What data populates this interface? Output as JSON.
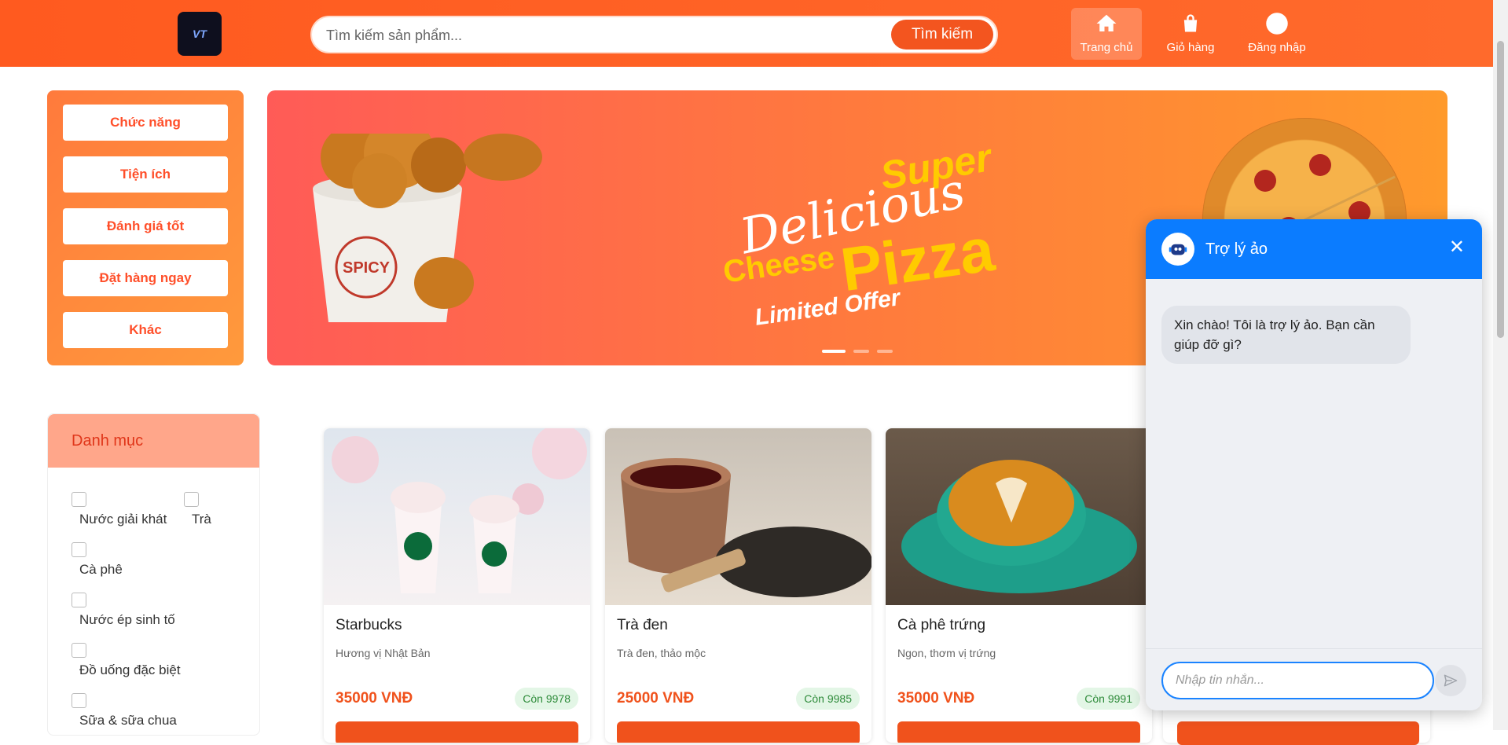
{
  "header": {
    "logo_text": "VT",
    "search_placeholder": "Tìm kiếm sản phẩm...",
    "search_button": "Tìm kiếm",
    "nav": [
      {
        "label": "Trang chủ",
        "icon": "home-icon",
        "active": true
      },
      {
        "label": "Giỏ hàng",
        "icon": "shopping-bag-icon",
        "active": false
      },
      {
        "label": "Đăng nhập",
        "icon": "user-circle-icon",
        "active": false
      }
    ]
  },
  "side_menu": [
    "Chức năng",
    "Tiện ích",
    "Đánh giá tốt",
    "Đặt hàng ngay",
    "Khác"
  ],
  "banner": {
    "line1": "Super",
    "line2": "Delicious",
    "line3": "Cheese",
    "line4": "Pizza",
    "line5": "Limited Offer",
    "bucket_text": "SPICY",
    "slide_count": 3,
    "active_slide": 1
  },
  "category": {
    "title": "Danh mục",
    "items": [
      "Nước giải khát",
      "Trà",
      "Cà phê",
      "Nước ép sinh tố",
      "Đồ uống đặc biệt",
      "Sữa & sữa chua"
    ]
  },
  "products": [
    {
      "name": "Starbucks",
      "desc": "Hương vị Nhật Bản",
      "price": "35000 VNĐ",
      "stock": "Còn 9978"
    },
    {
      "name": "Trà đen",
      "desc": "Trà đen, thảo mộc",
      "price": "25000 VNĐ",
      "stock": "Còn 9985"
    },
    {
      "name": "Cà phê trứng",
      "desc": "Ngon, thơm vị trứng",
      "price": "35000 VNĐ",
      "stock": "Còn 9991"
    }
  ],
  "chat": {
    "title": "Trợ lý ảo",
    "message": "Xin chào! Tôi là trợ lý ảo. Bạn cần giúp đỡ gì?",
    "input_placeholder": "Nhập tin nhắn...",
    "close": "✕"
  },
  "colors": {
    "primary": "#ff5a1f",
    "chat_blue": "#0b7cff",
    "stock_green": "#2e8b3a"
  }
}
